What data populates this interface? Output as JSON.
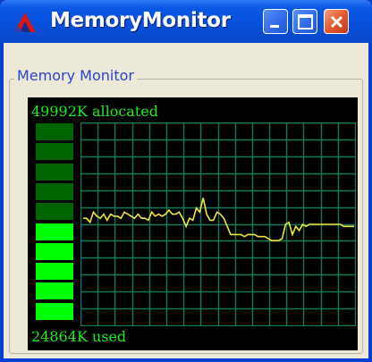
{
  "window": {
    "title": "MemoryMonitor",
    "icons": {
      "app": "app-logo-icon",
      "minimize": "minimize-icon",
      "maximize": "maximize-icon",
      "close": "close-icon"
    }
  },
  "group": {
    "label": "Memory Monitor"
  },
  "monitor": {
    "allocated_text": "49992K allocated",
    "used_text": "24864K used",
    "used_fraction": 0.5,
    "meter_segments": 10,
    "lit_segments": 5,
    "colors": {
      "background": "#000000",
      "text": "#1cf01c",
      "meter_lit": "#00ff00",
      "meter_dim": "#006400",
      "grid": "#127a5c",
      "trace": "#f0e641"
    },
    "grid": {
      "columns": 16,
      "rows": 12
    },
    "trace": [
      0.53,
      0.53,
      0.51,
      0.56,
      0.54,
      0.53,
      0.55,
      0.52,
      0.55,
      0.54,
      0.54,
      0.53,
      0.56,
      0.55,
      0.54,
      0.53,
      0.55,
      0.53,
      0.53,
      0.52,
      0.56,
      0.54,
      0.55,
      0.54,
      0.55,
      0.57,
      0.55,
      0.55,
      0.56,
      0.53,
      0.49,
      0.53,
      0.52,
      0.58,
      0.56,
      0.63,
      0.55,
      0.52,
      0.52,
      0.56,
      0.55,
      0.53,
      0.49,
      0.45,
      0.45,
      0.45,
      0.45,
      0.44,
      0.45,
      0.45,
      0.45,
      0.44,
      0.44,
      0.44,
      0.43,
      0.42,
      0.42,
      0.42,
      0.43,
      0.5,
      0.51,
      0.45,
      0.49,
      0.47,
      0.5,
      0.49,
      0.5,
      0.5,
      0.5,
      0.5,
      0.5,
      0.5,
      0.5,
      0.5,
      0.5,
      0.5,
      0.49,
      0.49,
      0.49,
      0.49
    ]
  }
}
